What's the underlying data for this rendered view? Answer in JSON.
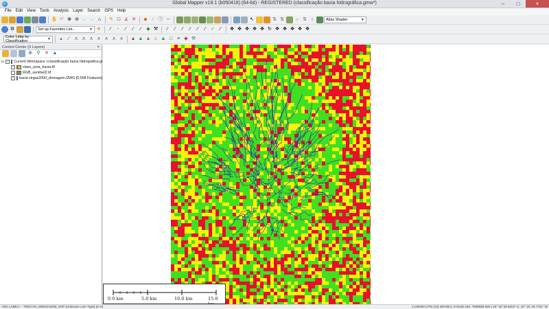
{
  "window": {
    "title": "Global Mapper v19.1 (b050418) (64-bit) - REGISTERED (classificação bacia hidrográfica.gmw*)"
  },
  "menu": [
    "File",
    "Edit",
    "View",
    "Tools",
    "Analysis",
    "Layer",
    "Search",
    "GPS",
    "Help"
  ],
  "toolbar": {
    "shader_select": "Atlas Shader",
    "favorites_select": "Set up Favorites List...",
    "lidar_select": "Color Lidar by Classification"
  },
  "control_center": {
    "title": "Control Center (3 Layers)",
    "close": "×",
    "workspace": "Current Workspace <classificação bacia hidrográfica.gmw>",
    "layers": [
      {
        "name": "class_area_bacia.tif",
        "checked": true
      },
      {
        "name": "RGB_sentinel2.tif",
        "checked": false
      },
      {
        "name": "bacia sirgas2000_drenagem.DWG [0,558 Features]",
        "checked": true
      }
    ]
  },
  "scale_bar": {
    "labels": [
      "0.0 km",
      "5.0 km",
      "10.0 km",
      "15.0 km"
    ]
  },
  "status": {
    "left": "<NO LABEL> - TRECHO_DRENAGEM_SHP [Unknown Line Type] (0 m)",
    "right": "1:159290  UTM (23)  WGS84  | 273249.182, 7969556.693 | 18° 20' 56.6204\" S, 43° 18' 29.7701\" W"
  },
  "colors": {
    "red": "#e8102a",
    "yellow": "#f6f20a",
    "green": "#40e020",
    "blue": "#2a2aa8",
    "close": "#c75050"
  }
}
